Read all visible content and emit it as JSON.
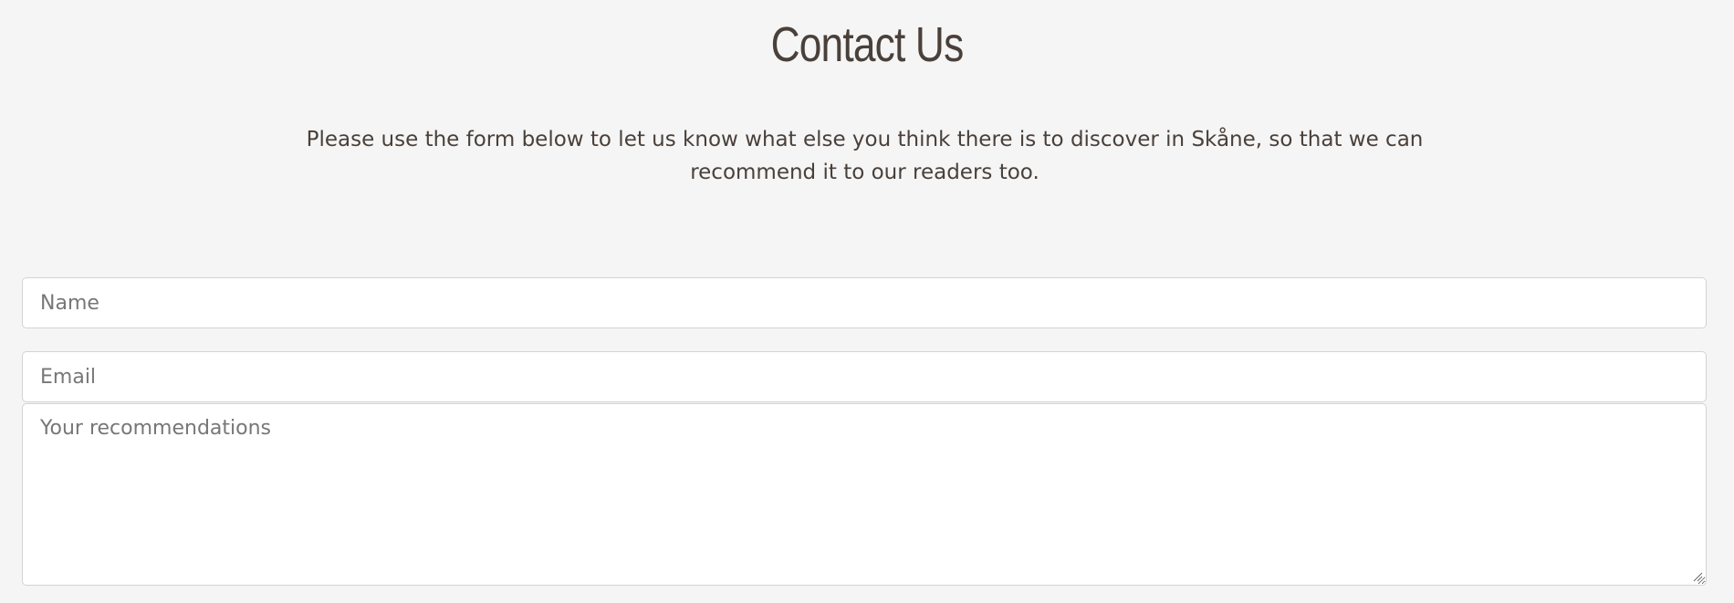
{
  "page": {
    "title": "Contact Us",
    "intro": "Please use the form below to let us know what else you think there is to discover in Skåne, so that we can recommend it to our readers too."
  },
  "form": {
    "name_placeholder": "Name",
    "email_placeholder": "Email",
    "message_placeholder": "Your recommendations"
  },
  "colors": {
    "background": "#f5f5f5",
    "text": "#4a403a",
    "field_border": "#d3d3d3"
  }
}
